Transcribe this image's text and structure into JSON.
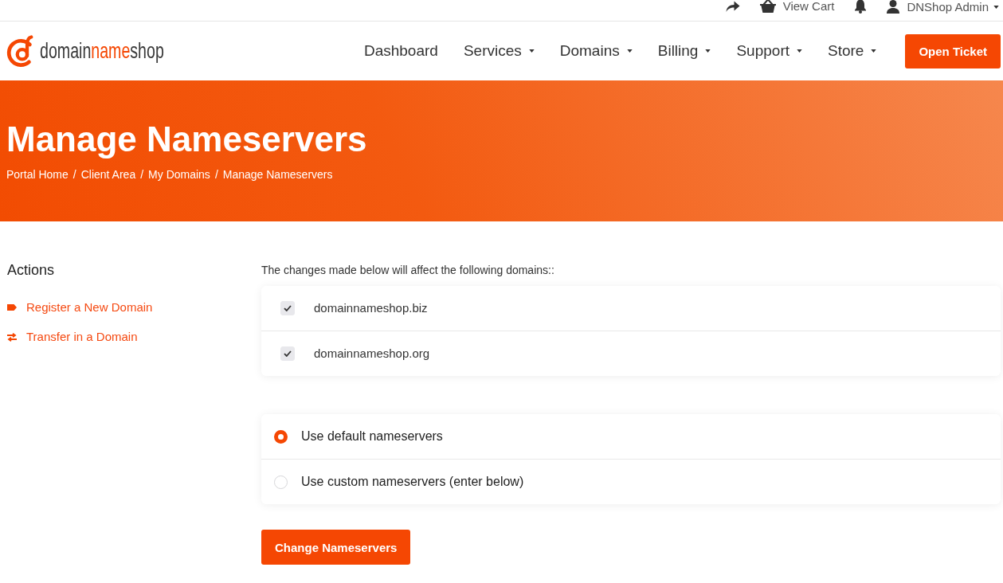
{
  "top_bar": {
    "cart_label": "View Cart",
    "account_name": "DNShop Admin"
  },
  "logo": {
    "parts": [
      {
        "text": "domain",
        "accent": false
      },
      {
        "text": "name",
        "accent": true
      },
      {
        "text": "shop",
        "accent": false
      }
    ]
  },
  "nav": [
    {
      "label": "Dashboard",
      "has_menu": false
    },
    {
      "label": "Services",
      "has_menu": true
    },
    {
      "label": "Domains",
      "has_menu": true
    },
    {
      "label": "Billing",
      "has_menu": true
    },
    {
      "label": "Support",
      "has_menu": true
    },
    {
      "label": "Store",
      "has_menu": true
    }
  ],
  "open_ticket": "Open Ticket",
  "hero": {
    "title": "Manage Nameservers",
    "breadcrumb": [
      {
        "label": "Portal Home"
      },
      {
        "separator": "/",
        "label": "Client Area"
      },
      {
        "separator": "/",
        "label": "My Domains"
      },
      {
        "separator": "/",
        "label": "Manage Nameservers"
      }
    ]
  },
  "sidebar": {
    "title": "Actions",
    "items": [
      {
        "kind": "register",
        "label": "Register a New Domain"
      },
      {
        "kind": "transfer",
        "label": "Transfer in a Domain"
      }
    ]
  },
  "intro": "The changes made below will affect the following domains::",
  "domains": [
    {
      "name": "domainnameshop.biz",
      "checked": true
    },
    {
      "name": "domainnameshop.org",
      "checked": true
    }
  ],
  "nameserver_options": [
    {
      "label": "Use default nameservers",
      "selected": true
    },
    {
      "label": "Use custom nameservers (enter below)",
      "selected": false
    }
  ],
  "submit_label": "Change Nameservers"
}
